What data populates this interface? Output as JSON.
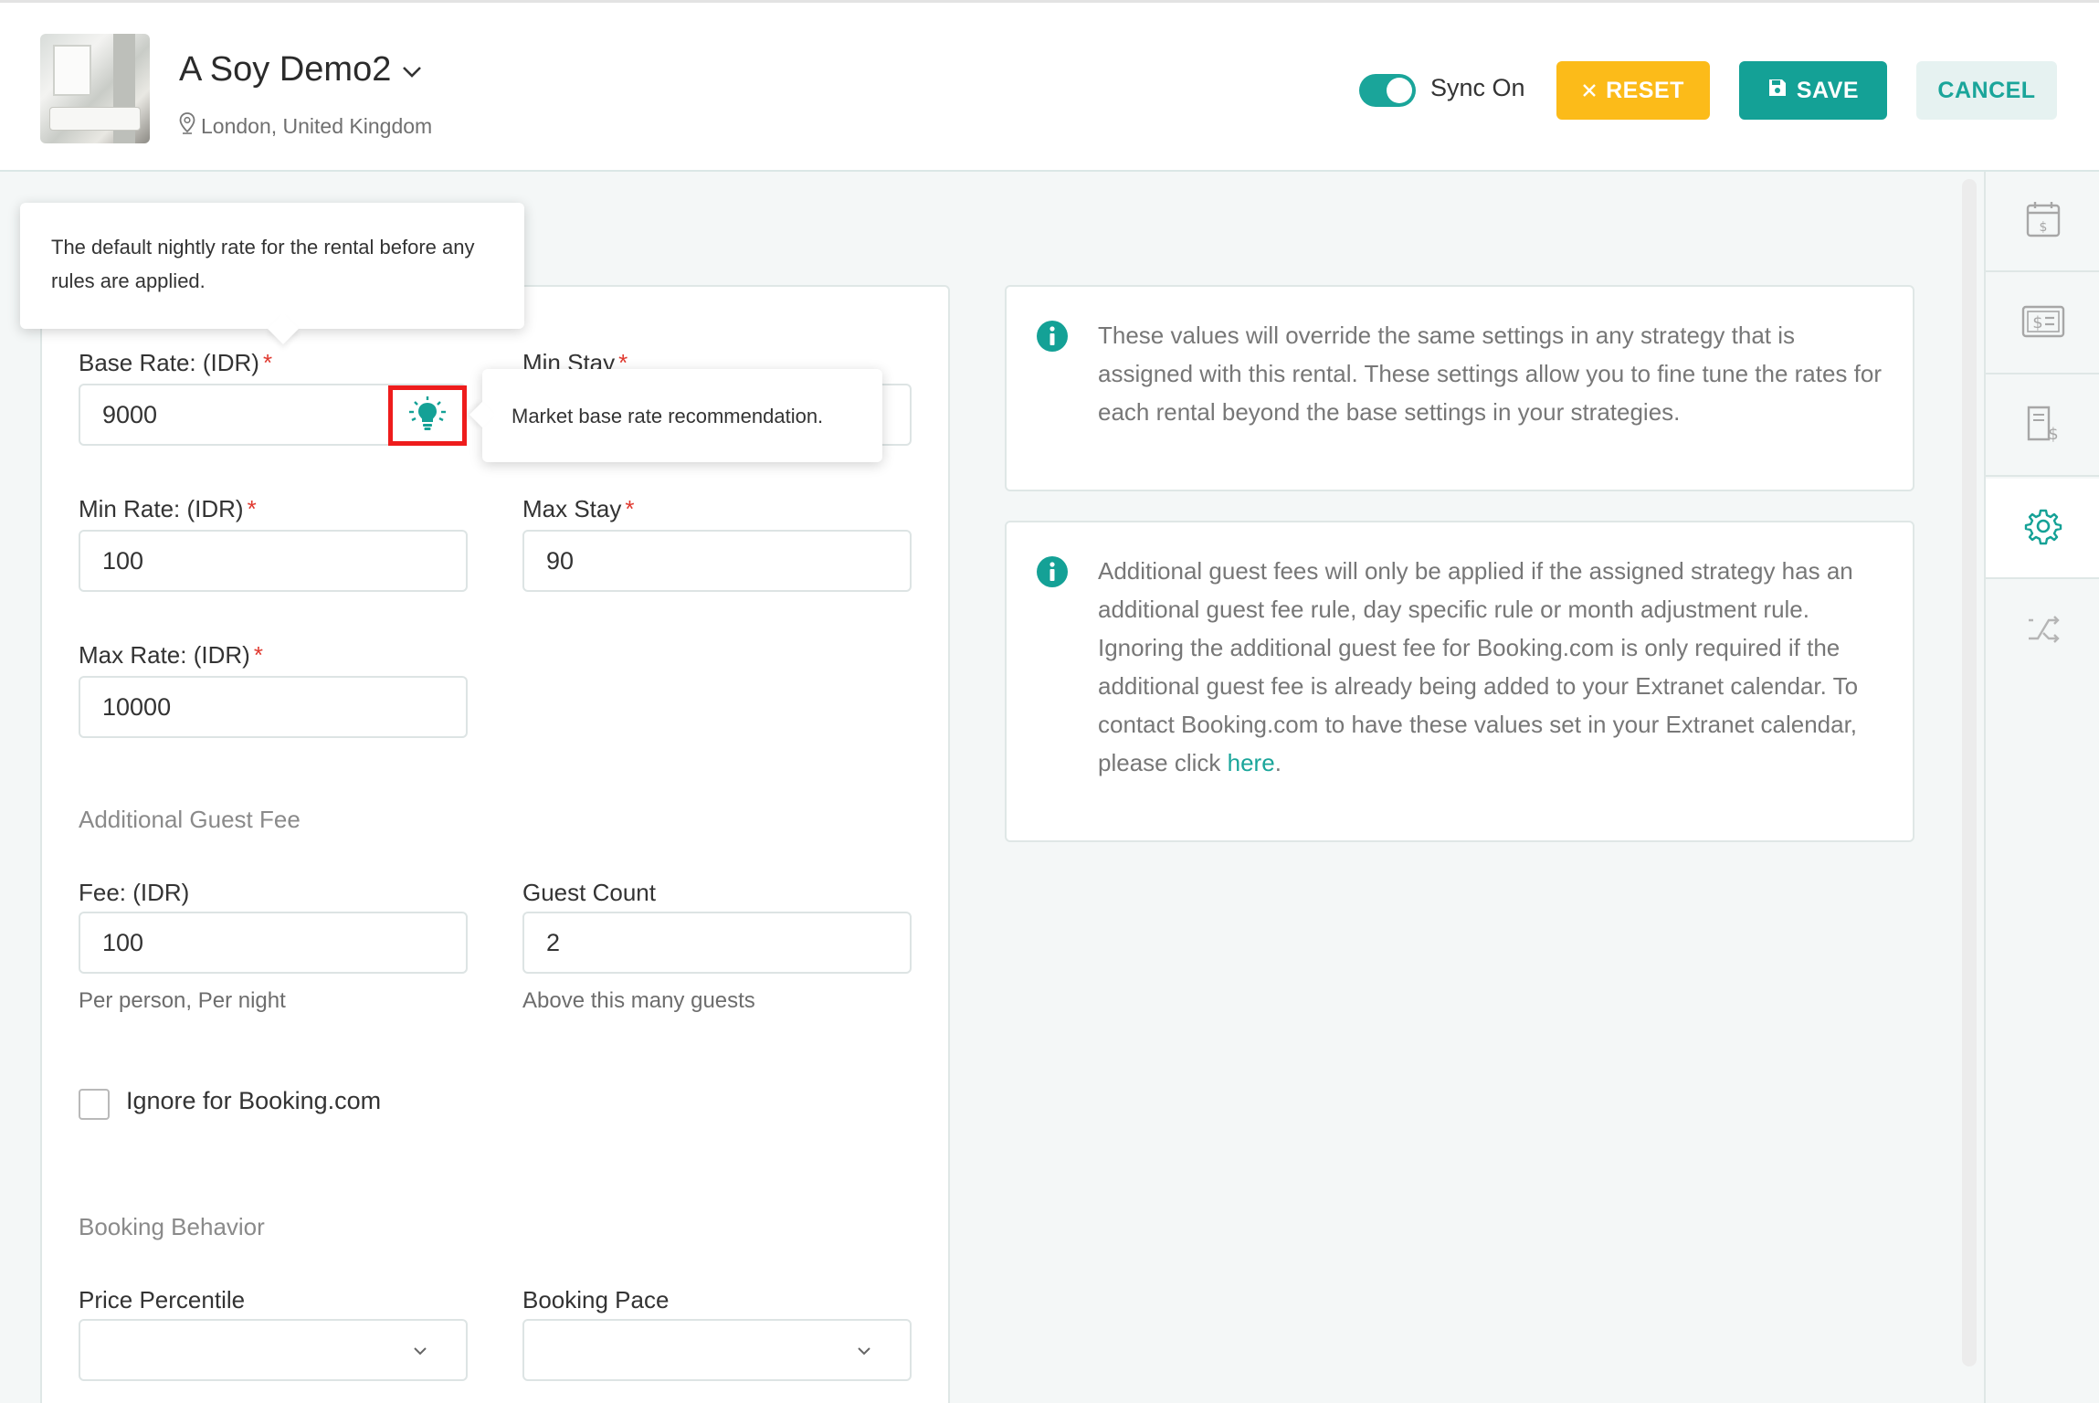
{
  "header": {
    "property_name": "A Soy Demo2",
    "location": "London, United Kingdom",
    "sync_label": "Sync On",
    "sync_on": true,
    "reset_label": "RESET",
    "save_label": "SAVE",
    "cancel_label": "CANCEL"
  },
  "tooltips": {
    "base_rate": "The default nightly rate for the rental before any rules are applied.",
    "market": "Market base rate recommendation."
  },
  "form": {
    "base_rate_label": "Base Rate: (IDR)",
    "base_rate_value": "9000",
    "min_stay_label": "Min Stay",
    "min_rate_label": "Min Rate: (IDR)",
    "min_rate_value": "100",
    "max_stay_label": "Max Stay",
    "max_stay_value": "90",
    "max_rate_label": "Max Rate: (IDR)",
    "max_rate_value": "10000",
    "required_mark": "*",
    "additional_guest_fee_heading": "Additional Guest Fee",
    "fee_label": "Fee: (IDR)",
    "fee_value": "100",
    "fee_help": "Per person, Per night",
    "guest_count_label": "Guest Count",
    "guest_count_value": "2",
    "guest_count_help": "Above this many guests",
    "ignore_booking_label": "Ignore for Booking.com",
    "ignore_booking_checked": false,
    "booking_behavior_heading": "Booking Behavior",
    "price_percentile_label": "Price Percentile",
    "price_percentile_value": "",
    "booking_pace_label": "Booking Pace",
    "booking_pace_value": ""
  },
  "info": {
    "override_text": "These values will override the same settings in any strategy that is assigned with this rental. These settings allow you to fine tune the rates for each rental beyond the base settings in your strategies.",
    "guest_fee_text": "Additional guest fees will only be applied if the assigned strategy has an additional guest fee rule, day specific rule or month adjustment rule. Ignoring the additional guest fee for Booking.com is only required if the additional guest fee is already being added to your Extranet calendar. To contact Booking.com to have these values set in your Extranet calendar, please click",
    "link_text": "here",
    "trailing": "."
  },
  "rail": {
    "items": [
      "calendar-dollar-icon",
      "money-bill-icon",
      "receipt-dollar-icon",
      "gear-icon",
      "shuffle-icon"
    ],
    "active_index": 3
  },
  "colors": {
    "accent": "#1aa59a",
    "reset": "#fcbb19",
    "required": "#e0392f",
    "highlight_border": "#ee1c1c"
  }
}
